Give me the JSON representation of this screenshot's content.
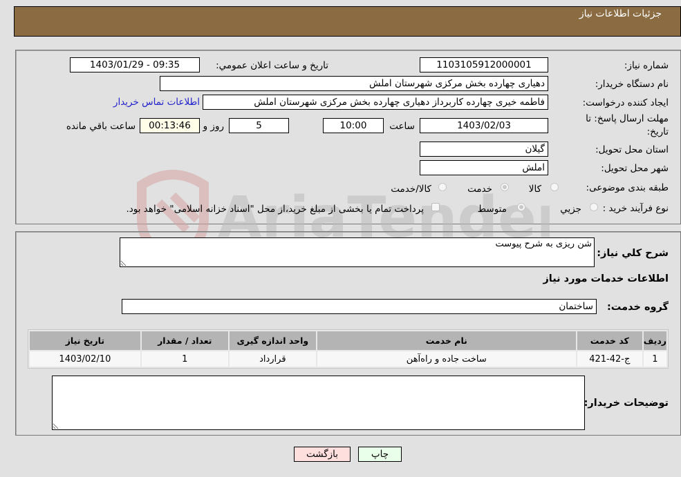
{
  "header": {
    "title": "جزئیات اطلاعات نیاز"
  },
  "fields": {
    "need_number": {
      "label": "شماره نیاز:",
      "value": "1103105912000001"
    },
    "announce_datetime": {
      "label": "تاریخ و ساعت اعلان عمومي:",
      "value": "1403/01/29 - 09:35"
    },
    "buyer_org": {
      "label": "نام دستگاه خریدار:",
      "value": "دهیاری چهارده بخش مرکزی شهرستان املش"
    },
    "requester": {
      "label": "ایجاد کننده درخواست:",
      "value": "فاطمه خیری چهارده کاربرداز دهیاری چهارده بخش مرکزی شهرستان املش"
    },
    "contact_link": "اطلاعات تماس خریدار",
    "deadline": {
      "label_line1": "مهلت ارسال پاسخ: تا",
      "label_line2": "تاریخ:",
      "date": "1403/02/03",
      "time_label": "ساعت",
      "time": "10:00",
      "days": "5",
      "days_label": "روز و",
      "remaining": "00:13:46",
      "remaining_label": "ساعت باقي مانده"
    },
    "province": {
      "label": "استان محل تحویل:",
      "value": "گیلان"
    },
    "city": {
      "label": "شهر محل تحویل:",
      "value": "املش"
    },
    "category": {
      "label": "طبقه بندی موضوعی:",
      "options": [
        "کالا",
        "خدمت",
        "کالا/خدمت"
      ],
      "selected": "خدمت"
    },
    "purchase_type": {
      "label": "نوع فرآیند خرید :",
      "options": [
        "جزيي",
        "متوسط"
      ],
      "selected": "متوسط",
      "treasury_note": "پرداخت تمام یا بخشی از مبلغ خرید،از محل \"اسناد خزانه اسلامی\" خواهد بود."
    }
  },
  "description": {
    "label": "شرح کلي نیاز:",
    "value": "شن ریزی به شرح پیوست"
  },
  "services_section_title": "اطلاعات خدمات مورد نیاز",
  "service_group": {
    "label": "گروه خدمت:",
    "value": "ساختمان"
  },
  "table": {
    "headers": [
      "ردیف",
      "کد خدمت",
      "نام خدمت",
      "واحد اندازه گیری",
      "تعداد / مقدار",
      "تاریخ نیاز"
    ],
    "rows": [
      [
        "1",
        "ج-42-421",
        "ساخت جاده و راه‌آهن",
        "قرارداد",
        "1",
        "1403/02/10"
      ]
    ]
  },
  "buyer_notes": {
    "label": "توضیحات خریدار:",
    "value": ""
  },
  "buttons": {
    "print": "چاپ",
    "back": "بازگشت"
  },
  "colors": {
    "header_bg": "#8b6b42",
    "print_bg": "#eaffea",
    "back_bg": "#ffdede",
    "link": "#2222cc"
  },
  "watermark": "AriaTender.neT"
}
